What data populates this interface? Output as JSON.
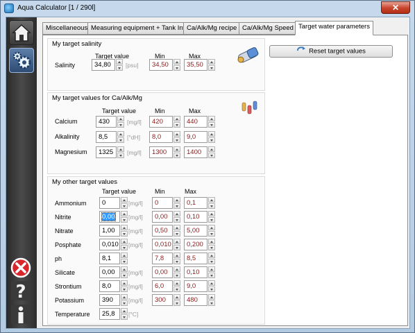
{
  "window": {
    "title": "Aqua Calculator [1 / 290l]",
    "close_label": "✕"
  },
  "tabs": [
    {
      "label": "Miscellaneous"
    },
    {
      "label": "Measuring equipment + Tank Info"
    },
    {
      "label": "Ca/Alk/Mg recipe"
    },
    {
      "label": "Ca/Alk/Mg Speed"
    },
    {
      "label": "Target water parameters"
    }
  ],
  "reset_button": {
    "label": "Reset target values"
  },
  "headers": {
    "target": "Target value",
    "min": "Min",
    "max": "Max"
  },
  "salinity_group": {
    "title": "My target salinity",
    "rows": [
      {
        "label": "Salinity",
        "target": "34,80",
        "unit": "[psu]",
        "min": "34,50",
        "max": "35,50"
      }
    ]
  },
  "camg_group": {
    "title": "My target values for Ca/Alk/Mg",
    "rows": [
      {
        "label": "Calcium",
        "target": "430",
        "unit": "[mg/l]",
        "min": "420",
        "max": "440"
      },
      {
        "label": "Alkalinity",
        "target": "8,5",
        "unit": "[°dH]",
        "min": "8,0",
        "max": "9,0"
      },
      {
        "label": "Magnesium",
        "target": "1325",
        "unit": "[mg/l]",
        "min": "1300",
        "max": "1400"
      }
    ]
  },
  "other_group": {
    "title": "My other target values",
    "rows": [
      {
        "label": "Ammonium",
        "target": "0",
        "unit": "[mg/l]",
        "min": "0",
        "max": "0,1"
      },
      {
        "label": "Nitrite",
        "target": "0,00",
        "unit": "[mg/l]",
        "min": "0,00",
        "max": "0,10"
      },
      {
        "label": "Nitrate",
        "target": "1,00",
        "unit": "[mg/l]",
        "min": "0,50",
        "max": "5,00"
      },
      {
        "label": "Posphate",
        "target": "0,010",
        "unit": "[mg/l]",
        "min": "0,010",
        "max": "0,200"
      },
      {
        "label": "ph",
        "target": "8,1",
        "unit": "",
        "min": "7,8",
        "max": "8,5"
      },
      {
        "label": "Silicate",
        "target": "0,00",
        "unit": "[mg/l]",
        "min": "0,00",
        "max": "0,10"
      },
      {
        "label": "Strontium",
        "target": "8,0",
        "unit": "[mg/l]",
        "min": "6,0",
        "max": "9,0"
      },
      {
        "label": "Potassium",
        "target": "390",
        "unit": "[mg/l]",
        "min": "300",
        "max": "480"
      },
      {
        "label": "Temperature",
        "target": "25,8",
        "unit": "[°C]",
        "min": "",
        "max": ""
      }
    ]
  },
  "sidebar_icons": [
    "home-icon",
    "gear-icon",
    "close-circle-icon",
    "question-icon",
    "info-icon"
  ],
  "colors": {
    "minmax_text": "#8b1a1a",
    "selection": "#3399ff"
  }
}
